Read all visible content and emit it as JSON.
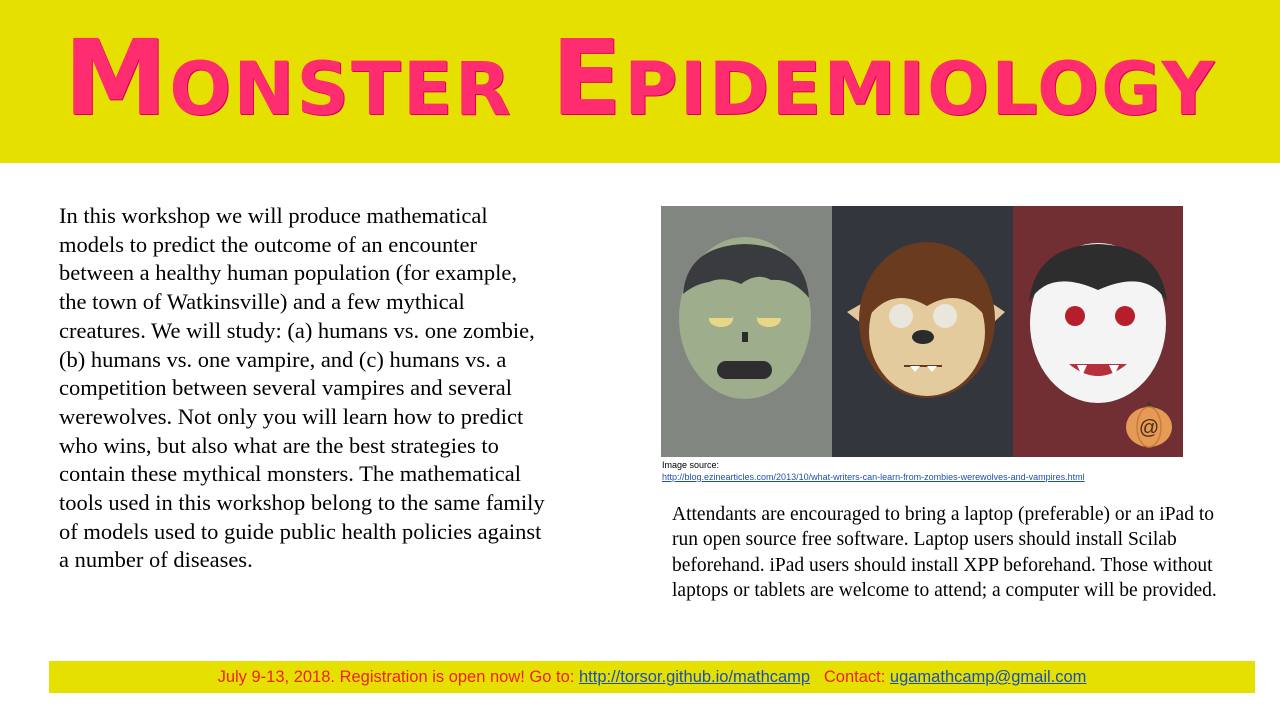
{
  "title": "Monster Epidemiology",
  "description": "In this workshop we will produce mathematical models to predict the outcome of an encounter between a healthy human population (for example, the town of Watkinsville) and a few mythical creatures. We will study: (a) humans vs. one zombie, (b) humans vs. one vampire, and (c) humans vs. a competition between several vampires and several werewolves. Not only you will learn how to predict who wins, but also what are the best strategies to contain these mythical monsters. The mathematical tools used in this workshop belong to the same family of models used to guide public health policies against a number of diseases.",
  "image": {
    "caption_label": "Image source:",
    "caption_url": "http://blog.ezinearticles.com/2013/10/what-writers-can-learn-from-zombies-werewolves-and-vampires.html",
    "pumpkin_symbol": "@",
    "colors": {
      "zombie_panel": "#828680",
      "werewolf_panel": "#33363d",
      "vampire_panel": "#722f33"
    }
  },
  "attendance_note": "Attendants are encouraged to bring a laptop (preferable) or an iPad to run open source free software. Laptop users should install Scilab beforehand. iPad users should install XPP beforehand. Those without laptops or tablets are welcome to attend; a computer will be provided.",
  "footer": {
    "dates_text": "July 9-13, 2018.  Registration is open now!  Go to:",
    "website": "http://torsor.github.io/mathcamp",
    "contact_label": "Contact:",
    "email": "ugamathcamp@gmail.com"
  }
}
